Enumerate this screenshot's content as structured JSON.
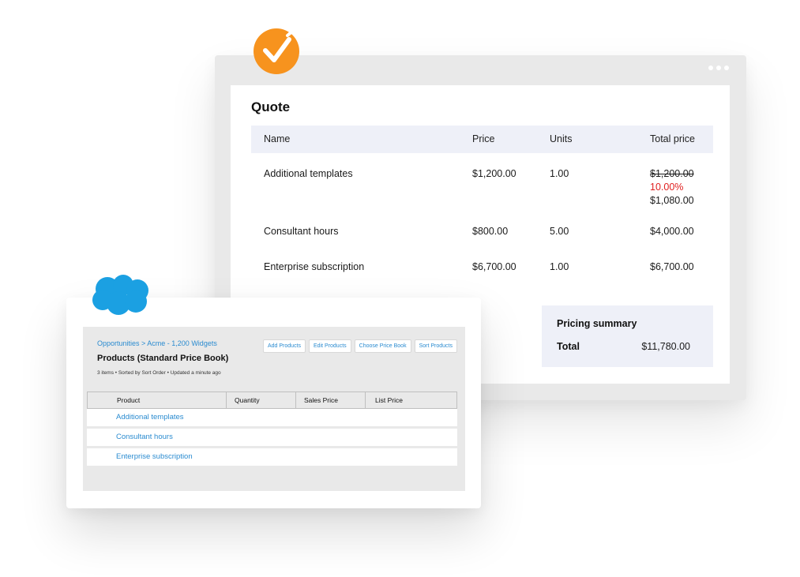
{
  "quote": {
    "title": "Quote",
    "columns": [
      "Name",
      "Price",
      "Units",
      "Total price"
    ],
    "rows": [
      {
        "name": "Additional templates",
        "price": "$1,200.00",
        "units": "1.00",
        "total_original": "$1,200.00",
        "discount": "10.00%",
        "total": "$1,080.00"
      },
      {
        "name": "Consultant hours",
        "price": "$800.00",
        "units": "5.00",
        "total": "$4,000.00"
      },
      {
        "name": "Enterprise subscription",
        "price": "$6,700.00",
        "units": "1.00",
        "total": "$6,700.00"
      }
    ],
    "summary": {
      "title": "Pricing summary",
      "total_label": "Total",
      "total_value": "$11,780.00"
    }
  },
  "products": {
    "breadcrumb": "Opportunities > Acme - 1,200 Widgets",
    "title": "Products (Standard Price Book)",
    "meta": "3 items • Sorted by Sort Order • Updated a minute ago",
    "actions": [
      "Add Products",
      "Edit Products",
      "Choose Price Book",
      "Sort Products"
    ],
    "columns": [
      "Product",
      "Quantity",
      "Sales Price",
      "List Price"
    ],
    "rows": [
      "Additional templates",
      "Consultant hours",
      "Enterprise subscription"
    ]
  },
  "icons": {
    "badge": "check-icon",
    "brand": "cloud-icon"
  },
  "colors": {
    "accent_orange": "#f7931e",
    "cloud_blue": "#1ba0e2",
    "link_blue": "#2a8bd0",
    "discount_red": "#e02020"
  }
}
